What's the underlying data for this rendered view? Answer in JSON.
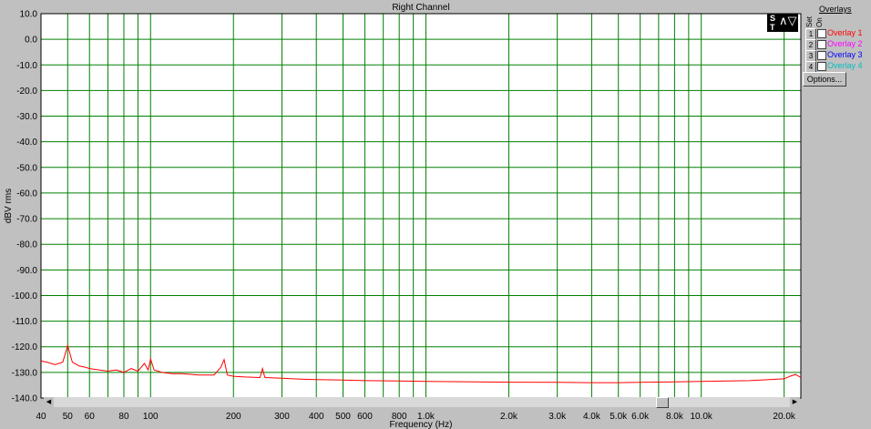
{
  "chart_data": {
    "type": "line",
    "title": "Right Channel",
    "xlabel": "Frequency (Hz)",
    "ylabel": "dBV rms",
    "xscale": "log",
    "xlim": [
      40,
      23000
    ],
    "ylim": [
      -140,
      10
    ],
    "grid": true,
    "yticks": [
      10,
      0,
      -10,
      -20,
      -30,
      -40,
      -50,
      -60,
      -70,
      -80,
      -90,
      -100,
      -110,
      -120,
      -130,
      -140
    ],
    "ytick_labels": [
      "10.0",
      "0.0",
      "-10.0",
      "-20.0",
      "-30.0",
      "-40.0",
      "-50.0",
      "-60.0",
      "-70.0",
      "-80.0",
      "-90.0",
      "-100.0",
      "-110.0",
      "-120.0",
      "-130.0",
      "-140.0"
    ],
    "xticks": [
      40,
      50,
      60,
      80,
      100,
      200,
      300,
      400,
      500,
      600,
      800,
      1000,
      2000,
      3000,
      4000,
      5000,
      6000,
      8000,
      10000,
      20000
    ],
    "xtick_labels": [
      "40",
      "50",
      "60",
      "80",
      "100",
      "200",
      "300",
      "400",
      "500",
      "600",
      "800",
      "1.0k",
      "2.0k",
      "3.0k",
      "4.0k",
      "5.0k",
      "6.0k",
      "8.0k",
      "10.0k",
      "20.0k"
    ],
    "xgrid": [
      40,
      50,
      60,
      70,
      80,
      90,
      100,
      200,
      300,
      400,
      500,
      600,
      700,
      800,
      900,
      1000,
      2000,
      3000,
      4000,
      5000,
      6000,
      7000,
      8000,
      9000,
      10000,
      20000
    ],
    "series": [
      {
        "color": "#ff0000",
        "x": [
          40,
          42,
          45,
          48,
          50,
          52,
          55,
          58,
          60,
          65,
          70,
          75,
          80,
          85,
          90,
          95,
          98,
          100,
          103,
          110,
          120,
          130,
          150,
          170,
          180,
          185,
          190,
          200,
          220,
          250,
          255,
          260,
          300,
          350,
          400,
          500,
          600,
          800,
          1000,
          1500,
          2000,
          3000,
          4000,
          5000,
          6000,
          8000,
          10000,
          15000,
          20000,
          21000,
          22000,
          23000
        ],
        "y": [
          -125.5,
          -126,
          -127,
          -126,
          -119.5,
          -126,
          -127.5,
          -128,
          -128.5,
          -129,
          -129.5,
          -129,
          -130,
          -128.5,
          -129.5,
          -126.5,
          -129,
          -124.8,
          -129,
          -130,
          -130.5,
          -130.5,
          -131,
          -131,
          -128,
          -125,
          -131,
          -131.5,
          -131.8,
          -132,
          -128.5,
          -132,
          -132.3,
          -132.6,
          -132.8,
          -133,
          -133.2,
          -133.3,
          -133.5,
          -133.7,
          -133.8,
          -133.9,
          -134,
          -134,
          -133.9,
          -133.7,
          -133.5,
          -133.2,
          -132.5,
          -131.5,
          -130.8,
          -132
        ]
      }
    ]
  },
  "overlays": {
    "title": "Overlays",
    "col_set": "Set",
    "col_on": "On",
    "items": [
      {
        "num": "1",
        "label": "Overlay 1",
        "color": "#ff0000"
      },
      {
        "num": "2",
        "label": "Overlay 2",
        "color": "#ff00ff"
      },
      {
        "num": "3",
        "label": "Overlay 3",
        "color": "#0000ff"
      },
      {
        "num": "4",
        "label": "Overlay 4",
        "color": "#00c0c0"
      }
    ],
    "options_label": "Options..."
  },
  "logo": {
    "s": "S",
    "t": "T",
    "wave": "∧▽"
  },
  "colors": {
    "plot_bg": "#ffffff",
    "grid": "#008000",
    "trace": "#ff0000"
  }
}
